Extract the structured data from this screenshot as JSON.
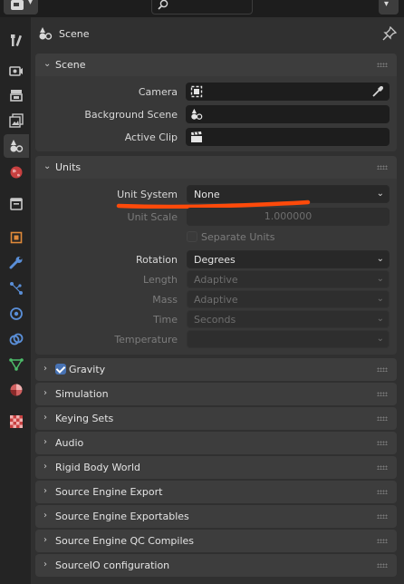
{
  "header": {
    "title": "Scene"
  },
  "scene_panel": {
    "title": "Scene",
    "rows": [
      {
        "label": "Camera"
      },
      {
        "label": "Background Scene"
      },
      {
        "label": "Active Clip"
      }
    ]
  },
  "units_panel": {
    "title": "Units",
    "unit_system": {
      "label": "Unit System",
      "value": "None"
    },
    "unit_scale": {
      "label": "Unit Scale",
      "value": "1.000000"
    },
    "separate_units": {
      "label": "Separate Units",
      "checked": false
    },
    "rotation": {
      "label": "Rotation",
      "value": "Degrees"
    },
    "length": {
      "label": "Length",
      "value": "Adaptive"
    },
    "mass": {
      "label": "Mass",
      "value": "Adaptive"
    },
    "time": {
      "label": "Time",
      "value": "Seconds"
    },
    "temperature": {
      "label": "Temperature",
      "value": ""
    }
  },
  "collapsed_panels": [
    {
      "title": "Gravity",
      "checked": true
    },
    {
      "title": "Simulation"
    },
    {
      "title": "Keying Sets"
    },
    {
      "title": "Audio"
    },
    {
      "title": "Rigid Body World"
    },
    {
      "title": "Source Engine Export"
    },
    {
      "title": "Source Engine Exportables"
    },
    {
      "title": "Source Engine QC Compiles"
    },
    {
      "title": "SourceIO configuration"
    }
  ],
  "sidebar_tabs": [
    "tool-icon",
    "render-icon",
    "output-icon",
    "view-layer-icon",
    "scene-icon",
    "world-icon",
    "collection-icon",
    "object-icon",
    "modifier-icon",
    "particles-icon",
    "physics-icon",
    "constraints-icon",
    "data-icon",
    "material-icon",
    "texture-icon"
  ],
  "colors": {
    "accent": "#4772b3",
    "annotation": "#ff4a0a"
  }
}
